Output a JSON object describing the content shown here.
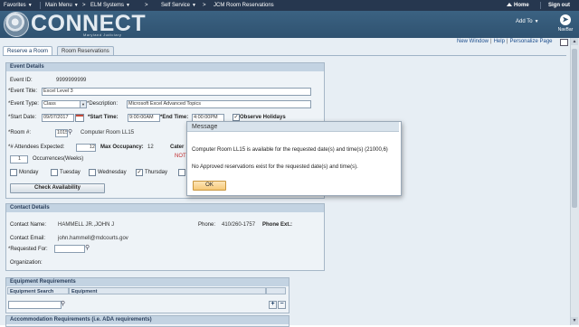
{
  "topbar": {
    "favorites": "Favorites",
    "main_menu": "Main Menu",
    "elm_systems": "ELM Systems",
    "self_service": "Self Service",
    "breadcrumb_current": "JCM Room Reservations",
    "home": "Home",
    "sign_out": "Sign out",
    "separator": ">",
    "caret": "▼"
  },
  "banner": {
    "logo_text": "CONNECT",
    "logo_subtext": "Maryland Judiciary",
    "add_to": "Add To",
    "navbar": "NavBar"
  },
  "utility_links": {
    "new_window": "New Window",
    "help": "Help",
    "personalize": "Personalize Page",
    "divider": "|"
  },
  "tabs": [
    {
      "label": "Reserve a Room"
    },
    {
      "label": "Room Reservations"
    }
  ],
  "event_details": {
    "header": "Event Details",
    "event_id_label": "Event ID:",
    "event_id_value": "9999999999",
    "event_title_label": "*Event Title:",
    "event_title_value": "Excel Level 3",
    "event_type_label": "*Event Type:",
    "event_type_value": "Class",
    "description_label": "*Description:",
    "description_value": "Microsoft Excel Advanced Topics",
    "start_date_label": "*Start Date:",
    "start_date_value": "09/07/2017",
    "start_time_label": "*Start Time:",
    "start_time_value": "9:00:00AM",
    "end_time_label": "*End Time:",
    "end_time_value": "4:00:00PM",
    "observe_holidays_label": "Observe Holidays",
    "observe_holidays_checked": true,
    "room_label": "*Room #:",
    "room_value": "1015",
    "room_name": "Computer Room LL15",
    "attendees_label": "*# Attendees Expected:",
    "attendees_value": "12",
    "max_occupancy_label": "Max Occupancy:",
    "max_occupancy_value": "12",
    "cater_fragment": "Cater",
    "not_fragment": "NOT",
    "occurrences_value": "1",
    "occurrences_label": "Occurrences(Weeks)",
    "days": [
      {
        "label": "Monday",
        "checked": false
      },
      {
        "label": "Tuesday",
        "checked": false
      },
      {
        "label": "Wednesday",
        "checked": false
      },
      {
        "label": "Thursday",
        "checked": true
      }
    ],
    "check_availability": "Check Availability"
  },
  "contact_details": {
    "header": "Contact Details",
    "contact_name_label": "Contact Name:",
    "contact_name_value": "HAMMELL JR.,JOHN J",
    "phone_label": "Phone:",
    "phone_value": "410/260-1757",
    "phone_ext_label": "Phone Ext.:",
    "contact_email_label": "Contact Email:",
    "contact_email_value": "john.hammell@mdcourts.gov",
    "requested_for_label": "*Requested For:",
    "organization_label": "Organization:"
  },
  "equipment": {
    "header": "Equipment Requirements",
    "col_search": "Equipment Search",
    "col_equipment": "Equipment",
    "add": "+",
    "remove": "−"
  },
  "accommodation": {
    "header": "Accommodation Requirements (i.e. ADA requirements)"
  },
  "modal": {
    "title": "Message",
    "message_1": "Computer Room LL15 is available for the requested date(s) and time(s) (21000,6)",
    "message_2": "No Approved reservations exist for the requested date(s) and time(s).",
    "ok": "OK"
  },
  "colors": {
    "topbar": "#26374f",
    "banner": "#345a7a",
    "page_bg": "#e7eef4",
    "group_header": "#c3d3e2",
    "link": "#1d4e8d",
    "ok_button": "#f6c978"
  }
}
